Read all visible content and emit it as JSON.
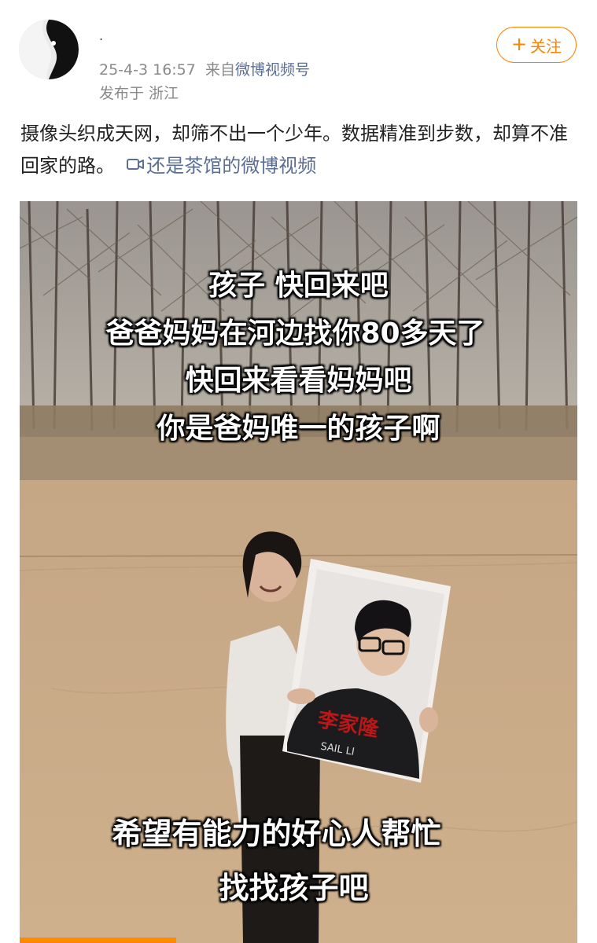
{
  "post": {
    "username": ".",
    "date": "25-4-3 16:57",
    "source_prefix": "来自",
    "source_name": "微博视频号",
    "location": "发布于 浙江",
    "follow_label": "关注",
    "body_text": "摄像头织成天网，却筛不出一个少年。数据精准到步数，却算不准回家的路。",
    "video_link_label": "还是茶馆的微博视频"
  },
  "video": {
    "captions_top": [
      "孩子 快回来吧",
      "爸爸妈妈在河边找你80多天了",
      "快回来看看妈妈吧",
      "你是爸妈唯一的孩子啊"
    ],
    "captions_bottom": [
      "希望有能力的好心人帮忙",
      "找找孩子吧"
    ],
    "shirt_text": "李家隆",
    "shirt_text2": "SAIL LI",
    "progress": 0.28
  },
  "colors": {
    "accent": "#ff8200",
    "link": "#5b6f95",
    "meta_text": "#8a8a8a"
  },
  "icons": {
    "follow": "plus-icon",
    "video_link": "video-camera-icon"
  }
}
